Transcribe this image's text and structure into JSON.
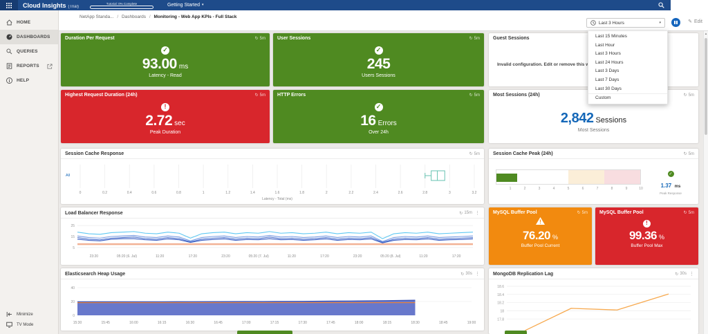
{
  "header": {
    "app_title": "Cloud Insights",
    "app_badge": "(Trial)",
    "tutorial_label": "Tutorial: 0% Complete",
    "getting_started": "Getting Started",
    "search_value": ""
  },
  "sidebar": {
    "items": [
      {
        "label": "HOME",
        "active": false
      },
      {
        "label": "DASHBOARDS",
        "active": true
      },
      {
        "label": "QUERIES",
        "active": false
      },
      {
        "label": "REPORTS",
        "active": false
      },
      {
        "label": "HELP",
        "active": false
      }
    ],
    "minimize_label": "Minimize",
    "tv_mode_label": "TV Mode"
  },
  "breadcrumb": {
    "account": "NetApp Standa...",
    "section": "Dashboards",
    "page": "Monitoring - Web App KPIs - Full Stack",
    "separator": "/"
  },
  "toolbar": {
    "time_range": "Last 3 Hours",
    "edit_label": "Edit",
    "menu_items": [
      "Last 15 Minutes",
      "Last Hour",
      "Last 3 Hours",
      "Last 24 Hours",
      "Last 3 Days",
      "Last 7 Days",
      "Last 30 Days",
      "Custom"
    ]
  },
  "widgets": {
    "duration_per_request": {
      "title": "Duration Per Request",
      "refresh": "5m",
      "value": "93.00",
      "unit": "ms",
      "caption": "Latency - Read"
    },
    "user_sessions": {
      "title": "User Sessions",
      "refresh": "5m",
      "value": "245",
      "unit": "",
      "caption": "Users Sessions"
    },
    "guest_sessions": {
      "title": "Guest Sessions",
      "message": "Invalid configuration. Edit or remove this widget."
    },
    "highest_request_duration": {
      "title": "Highest Request Duration (24h)",
      "refresh": "5m",
      "value": "2.72",
      "unit": "sec",
      "caption": "Peak Duration"
    },
    "http_errors": {
      "title": "HTTP Errors",
      "refresh": "5m",
      "value": "16",
      "unit": "Errors",
      "caption": "Over 24h"
    },
    "most_sessions": {
      "title": "Most Sessions (24h)",
      "refresh": "5m",
      "value": "2,842",
      "unit": "Sessions",
      "caption": "Most Sessions"
    },
    "session_cache_response": {
      "title": "Session Cache Response",
      "refresh": "5m"
    },
    "session_cache_peak": {
      "title": "Session Cache Peak (24h)",
      "refresh": "5m",
      "value": "1.37",
      "unit": "ms",
      "caption": "Peak Response"
    },
    "load_balancer_response": {
      "title": "Load Balancer Response",
      "refresh": "15m"
    },
    "mysql_buffer_pool_current": {
      "title": "MySQL Buffer Pool",
      "refresh": "5m",
      "value": "76.20",
      "unit": "%",
      "caption": "Buffer Pool Current"
    },
    "mysql_buffer_pool_max": {
      "title": "MySQL Buffer Pool",
      "refresh": "5m",
      "value": "99.36",
      "unit": "%",
      "caption": "Buffer Pool Max"
    },
    "elasticsearch_heap": {
      "title": "Elasticsearch Heap Usage",
      "refresh": "30s"
    },
    "mongodb_replication_lag": {
      "title": "MongoDB Replication Lag",
      "refresh": "30s"
    }
  },
  "colors": {
    "header_navy": "#1e4b8a",
    "green": "#4f8a21",
    "red": "#d8262c",
    "orange": "#f28a0f",
    "accent_blue": "#1467b8",
    "boxplot_teal": "#66c2b0"
  },
  "chart_data": [
    {
      "id": "session_cache_response",
      "type": "boxplot",
      "title": "Session Cache Response",
      "category": "All",
      "xlabel": "Latency - Total (ms)",
      "xlim": [
        0,
        3.2
      ],
      "xticks": [
        "0",
        "0.2",
        "0.4",
        "0.6",
        "0.8",
        "1",
        "1.2",
        "1.4",
        "1.6",
        "1.8",
        "2",
        "2.2",
        "2.4",
        "2.6",
        "2.8",
        "3",
        "3.2"
      ],
      "box": {
        "low": 2.8,
        "q1": 2.85,
        "median": 2.9,
        "q3": 2.96,
        "high": 2.96
      },
      "color": "#66c2b0",
      "grid": true
    },
    {
      "id": "session_cache_peak",
      "type": "bullet",
      "title": "Session Cache Peak (24h)",
      "value": 1.37,
      "unit": "ms",
      "caption": "Peak Response",
      "xlim": [
        0,
        10
      ],
      "ticks": [
        1,
        2,
        3,
        4,
        5,
        6,
        7,
        8,
        9,
        10
      ],
      "bar_end": 1.45,
      "bar_color": "#4f8a21",
      "zones": [
        {
          "from": 0,
          "to": 5,
          "color": "#ffffff"
        },
        {
          "from": 5,
          "to": 7.5,
          "color": "#fbeed8"
        },
        {
          "from": 7.5,
          "to": 10,
          "color": "#f8dde0"
        }
      ]
    },
    {
      "id": "load_balancer_response",
      "type": "line",
      "title": "Load Balancer Response",
      "ylim": [
        3,
        27
      ],
      "yticks": [
        5,
        15,
        25
      ],
      "xticks": [
        "23:20",
        "05:20 (6. Jul)",
        "11:20",
        "17:20",
        "23:20",
        "05:20 (7. Jul)",
        "11:20",
        "17:20",
        "23:20",
        "05:20 (8. Jul)",
        "11:20",
        "17:20"
      ],
      "threshold_band": {
        "value": 8,
        "thickness": 1.6,
        "color": "#f0a582"
      },
      "series": [
        {
          "color": "#5fc8f2",
          "values": [
            19,
            17.5,
            17,
            18.5,
            19,
            19.5,
            18,
            17.5,
            19,
            18,
            13.5,
            17.5,
            18.5,
            19,
            17.5,
            18.5,
            18,
            19.5,
            18,
            18.5,
            17.5,
            18,
            19,
            17.5,
            18.5,
            18,
            19,
            13,
            17.5,
            18.5,
            18,
            19,
            17.5,
            18,
            18.5,
            19
          ]
        },
        {
          "color": "#7b9fe6",
          "values": [
            15.5,
            14,
            13.5,
            15,
            15.5,
            16,
            14.5,
            14,
            15.5,
            14.5,
            11,
            14,
            15,
            15.5,
            14,
            15,
            14.5,
            16,
            14.5,
            15,
            14,
            14.5,
            15.5,
            14,
            15,
            14.5,
            15.5,
            10.5,
            14,
            15,
            14.5,
            15.5,
            14,
            14.5,
            15,
            15.5
          ]
        },
        {
          "color": "#4f74cf",
          "values": [
            14,
            12.5,
            12,
            13.5,
            14,
            14.5,
            13,
            12.5,
            14,
            13,
            10.2,
            12.5,
            13.5,
            14,
            12.5,
            13.5,
            13,
            14.5,
            13,
            13.5,
            12.5,
            13,
            14,
            12.5,
            13.5,
            13,
            14,
            9.8,
            12.5,
            13.5,
            13,
            14,
            12.5,
            13,
            13.5,
            14
          ]
        },
        {
          "color": "#3a5ec2",
          "values": [
            12.5,
            11.5,
            11,
            12.5,
            13,
            13,
            12,
            11.5,
            12.8,
            12,
            9.6,
            11.5,
            12.3,
            12.8,
            11.5,
            12.3,
            12,
            13,
            12,
            12.3,
            11.5,
            12,
            12.8,
            11.5,
            12.3,
            12,
            12.8,
            9.2,
            11.5,
            12.3,
            12,
            12.8,
            11.5,
            12,
            12.3,
            12.8
          ]
        }
      ]
    },
    {
      "id": "elasticsearch_heap",
      "type": "area",
      "title": "Elasticsearch Heap Usage",
      "ylim": [
        0,
        44
      ],
      "yticks": [
        0,
        20,
        40
      ],
      "xticks": [
        "15:30",
        "15:45",
        "16:00",
        "16:15",
        "16:30",
        "16:45",
        "17:00",
        "17:15",
        "17:30",
        "17:45",
        "18:00",
        "18:15",
        "18:30",
        "18:45",
        "19:00"
      ],
      "series": [
        {
          "kind": "area",
          "color": "#5b6cc7",
          "stroke": "#3d53b4",
          "end_frac": 0.857,
          "values": [
            19.6,
            19.6,
            19.7,
            19.7,
            19.8,
            19.9,
            20,
            20.1,
            20.3,
            20.6,
            20.9,
            21.3,
            21.9
          ]
        },
        {
          "kind": "line",
          "color": "#e5813d",
          "end_frac": 0.857,
          "values": [
            18.4,
            18.4
          ]
        }
      ]
    },
    {
      "id": "mongodb_replication_lag",
      "type": "line",
      "title": "MongoDB Replication Lag",
      "ylim": [
        17.45,
        18.7
      ],
      "yticks": [
        17.8,
        18,
        18.2,
        18.4,
        18.6
      ],
      "series": [
        {
          "color": "#f7a94e",
          "points": [
            [
              0.1,
              17.52
            ],
            [
              0.35,
              18.06
            ],
            [
              0.6,
              18.02
            ],
            [
              0.88,
              18.41
            ]
          ]
        }
      ]
    }
  ]
}
